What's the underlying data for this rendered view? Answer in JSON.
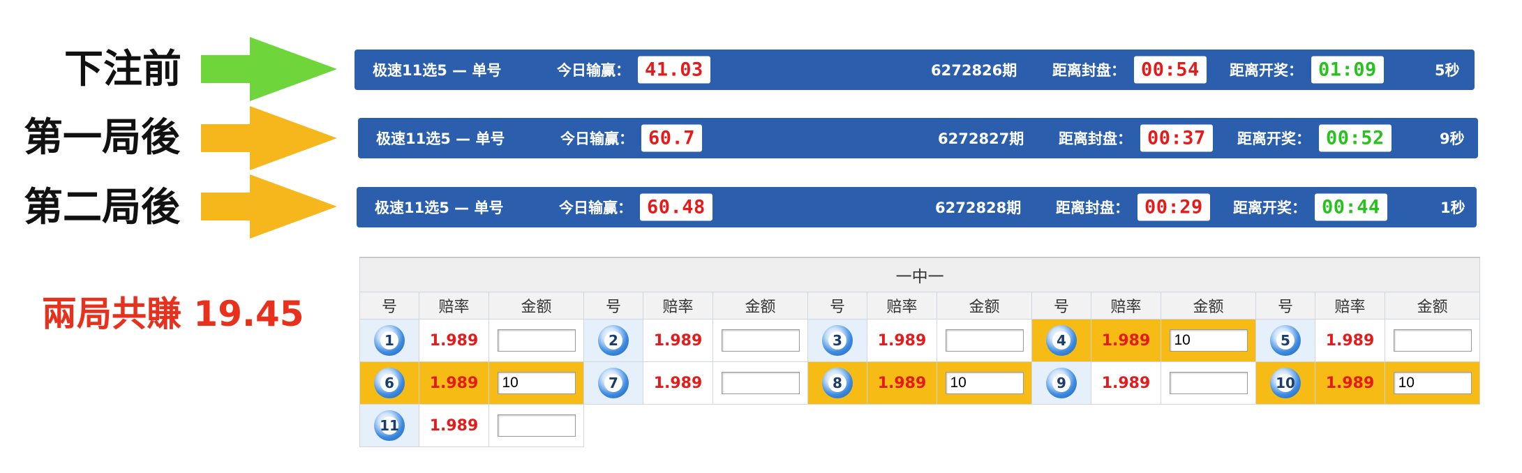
{
  "annotations": {
    "before_bet": "下注前",
    "after_round_1": "第一局後",
    "after_round_2": "第二局後",
    "summary": "兩局共賺 19.45",
    "arrow_colors": [
      "#6ed63a",
      "#f6b71d",
      "#f6b71d"
    ]
  },
  "bars": [
    {
      "game": "极速11选5 — 单号",
      "today_label": "今日输赢：",
      "today_value": "41.03",
      "period": "6272826期",
      "close_label": "距离封盘：",
      "close_time": "00:54",
      "draw_label": "距离开奖：",
      "draw_time": "01:09",
      "refresh": "5秒"
    },
    {
      "game": "极速11选5 — 单号",
      "today_label": "今日输赢：",
      "today_value": "60.7",
      "period": "6272827期",
      "close_label": "距离封盘：",
      "close_time": "00:37",
      "draw_label": "距离开奖：",
      "draw_time": "00:52",
      "refresh": "9秒"
    },
    {
      "game": "极速11选5 — 单号",
      "today_label": "今日输赢：",
      "today_value": "60.48",
      "period": "6272828期",
      "close_label": "距离封盘：",
      "close_time": "00:29",
      "draw_label": "距离开奖：",
      "draw_time": "00:44",
      "refresh": "1秒"
    }
  ],
  "table": {
    "caption": "一中一",
    "headers": {
      "number": "号",
      "odds": "赔率",
      "amount": "金额"
    },
    "cells": [
      {
        "num": "1",
        "odds": "1.989",
        "amount": "",
        "selected": false
      },
      {
        "num": "2",
        "odds": "1.989",
        "amount": "",
        "selected": false
      },
      {
        "num": "3",
        "odds": "1.989",
        "amount": "",
        "selected": false
      },
      {
        "num": "4",
        "odds": "1.989",
        "amount": "10",
        "selected": true
      },
      {
        "num": "5",
        "odds": "1.989",
        "amount": "",
        "selected": false
      },
      {
        "num": "6",
        "odds": "1.989",
        "amount": "10",
        "selected": true
      },
      {
        "num": "7",
        "odds": "1.989",
        "amount": "",
        "selected": false
      },
      {
        "num": "8",
        "odds": "1.989",
        "amount": "10",
        "selected": true
      },
      {
        "num": "9",
        "odds": "1.989",
        "amount": "",
        "selected": false
      },
      {
        "num": "10",
        "odds": "1.989",
        "amount": "10",
        "selected": true
      },
      {
        "num": "11",
        "odds": "1.989",
        "amount": "",
        "selected": false
      }
    ]
  },
  "colors": {
    "bar_blue": "#2b5fad",
    "odds_red": "#e51b1b",
    "timer_green": "#27c21d",
    "selected_yellow": "#f6bb14",
    "summary_red": "#e8311c"
  }
}
